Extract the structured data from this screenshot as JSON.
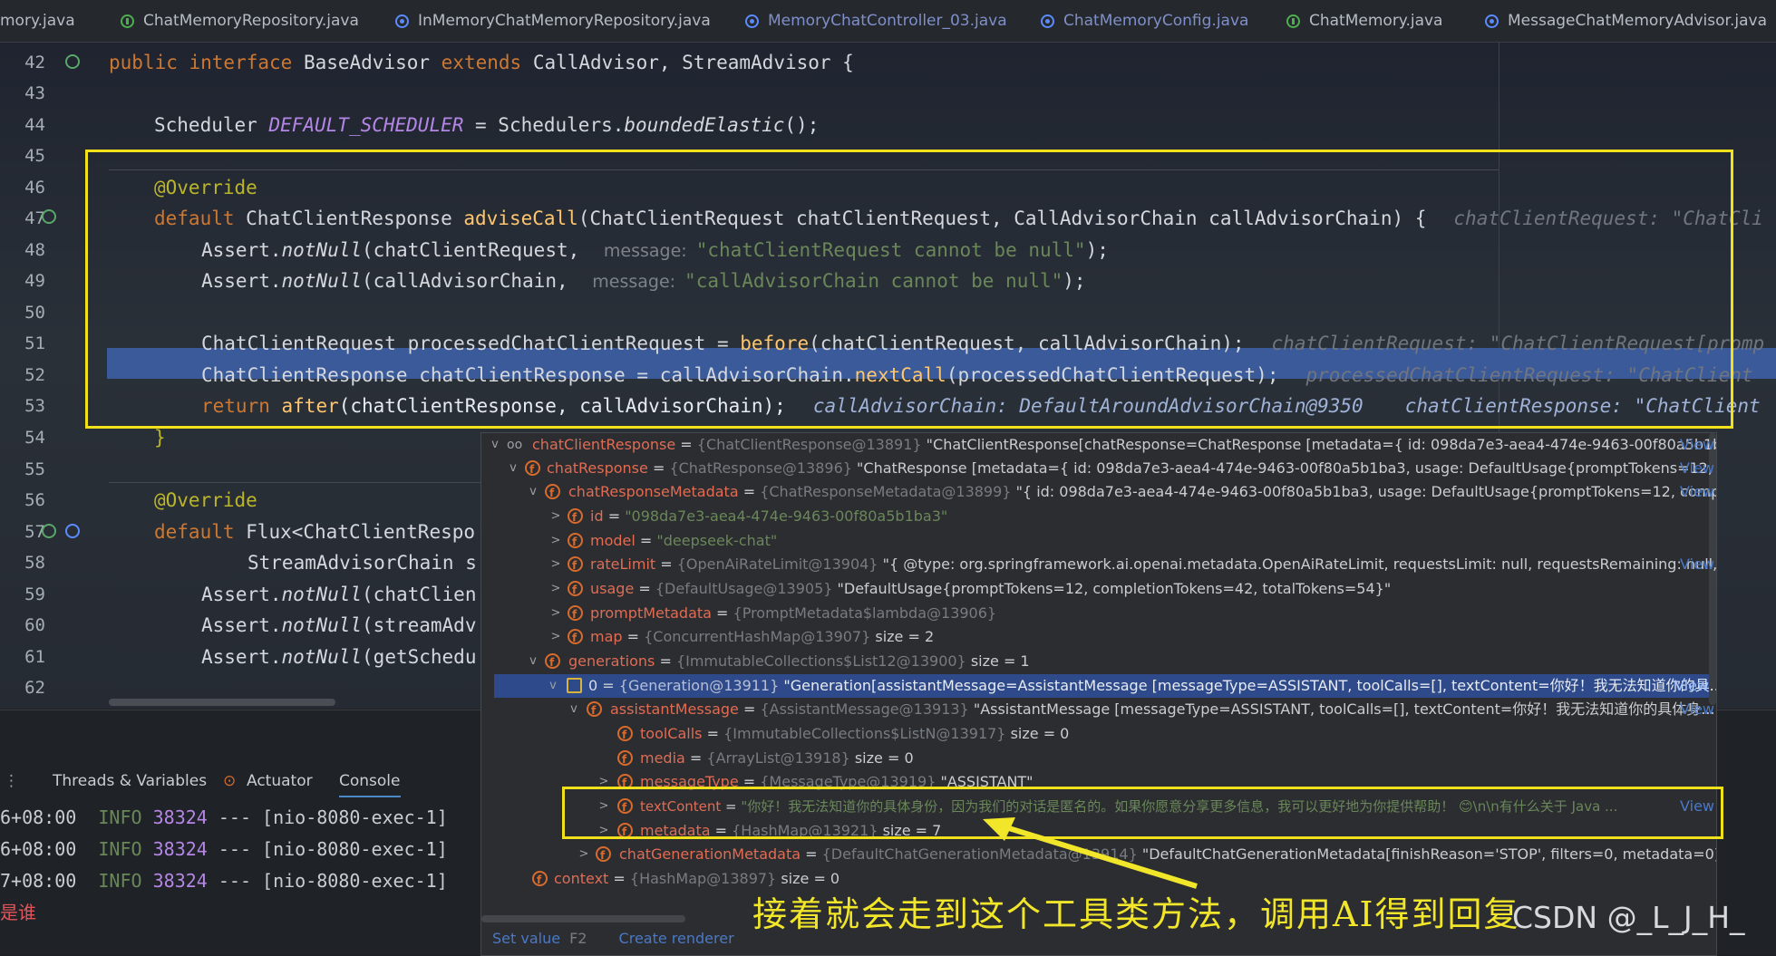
{
  "tabs": [
    {
      "label": "mory.java",
      "icon": "none"
    },
    {
      "label": "ChatMemoryRepository.java",
      "icon": "interface-icon"
    },
    {
      "label": "InMemoryChatMemoryRepository.java",
      "icon": "class-icon"
    },
    {
      "label": "MemoryChatController_03.java",
      "icon": "class-icon"
    },
    {
      "label": "ChatMemoryConfig.java",
      "icon": "class-icon"
    },
    {
      "label": "ChatMemory.java",
      "icon": "interface-icon"
    },
    {
      "label": "MessageChatMemoryAdvisor.java",
      "icon": "class-icon"
    }
  ],
  "editor": {
    "line_numbers": [
      "42",
      "43",
      "44",
      "45",
      "46",
      "47",
      "48",
      "49",
      "50",
      "51",
      "52",
      "53",
      "54",
      "55",
      "56",
      "57",
      "58",
      "59",
      "60",
      "61",
      "62"
    ],
    "l42": {
      "a": "public interface ",
      "b": "BaseAdvisor ",
      "c": "extends ",
      "d": "CallAdvisor, StreamAdvisor {"
    },
    "l44": {
      "a": "Scheduler ",
      "b": "DEFAULT_SCHEDULER",
      "c": " = Schedulers.",
      "d": "boundedElastic",
      "e": "();"
    },
    "l46": "@Override",
    "l47": {
      "a": "default ",
      "b": "ChatClientResponse ",
      "c": "adviseCall",
      "d": "(ChatClientRequest chatClientRequest, CallAdvisorChain callAdvisorChain) {",
      "hint": "chatClientRequest: \"ChatCli"
    },
    "l48": {
      "a": "Assert.",
      "b": "notNull",
      "c": "(chatClientRequest, ",
      "hint": "message:",
      "d": "\"chatClientRequest cannot be null\"",
      "e": ");"
    },
    "l49": {
      "a": "Assert.",
      "b": "notNull",
      "c": "(callAdvisorChain, ",
      "hint": "message:",
      "d": "\"callAdvisorChain cannot be null\"",
      "e": ");"
    },
    "l51": {
      "a": "ChatClientRequest processedChatClientRequest = ",
      "b": "before",
      "c": "(chatClientRequest, callAdvisorChain);",
      "hint": "chatClientRequest: \"ChatClientRequest[promp"
    },
    "l52": {
      "a": "ChatClientResponse chatClientResponse = callAdvisorChain.",
      "b": "nextCall",
      "c": "(processedChatClientRequest);",
      "hint": "processedChatClientRequest: \"ChatClient"
    },
    "l53": {
      "a": "return ",
      "b": "after",
      "c": "(chatClientResponse, callAdvisorChain);",
      "hint1": "callAdvisorChain: DefaultAroundAdvisorChain@9350",
      "hint2": "chatClientResponse: \"ChatClient"
    },
    "l54": "}",
    "l56": "@Override",
    "l57": {
      "a": "default ",
      "b": "Flux<ChatClientRespo"
    },
    "l58": "StreamAdvisorChain s",
    "l59": {
      "a": "Assert.",
      "b": "notNull",
      "c": "(chatClien"
    },
    "l60": {
      "a": "Assert.",
      "b": "notNull",
      "c": "(streamAdv"
    },
    "l61": {
      "a": "Assert.",
      "b": "notNull",
      "c": "(getSchedu"
    }
  },
  "bottom_tabs": {
    "threads": "Threads & Variables",
    "actuator": "Actuator",
    "console": "Console"
  },
  "console": [
    {
      "ts": "6+08:00",
      "level": "INFO",
      "pid": "38324",
      "rest": "--- [nio-8080-exec-1]"
    },
    {
      "ts": "6+08:00",
      "level": "INFO",
      "pid": "38324",
      "rest": "--- [nio-8080-exec-1]"
    },
    {
      "ts": "7+08:00",
      "level": "INFO",
      "pid": "38324",
      "rest": "--- [nio-8080-exec-1]"
    },
    {
      "ts": "是谁",
      "level": "",
      "pid": "",
      "rest": ""
    }
  ],
  "variables": [
    {
      "name": "chatClientResponse",
      "type": "{ChatClientResponse@13891}",
      "val": "\"ChatClientResponse[chatResponse=ChatResponse [metadata={ id: 098da7e3-aea4-474e-9463-00f80a5b1ba...",
      "view": "View",
      "icon": "oo",
      "arrow": "v"
    },
    {
      "name": "chatResponse",
      "type": "{ChatResponse@13896}",
      "val": "\"ChatResponse [metadata={ id: 098da7e3-aea4-474e-9463-00f80a5b1ba3, usage: DefaultUsage{promptTokens=12, c...",
      "view": "View",
      "icon": "f",
      "arrow": "v"
    },
    {
      "name": "chatResponseMetadata",
      "type": "{ChatResponseMetadata@13899}",
      "val": "\"{ id: 098da7e3-aea4-474e-9463-00f80a5b1ba3, usage: DefaultUsage{promptTokens=12, comp...",
      "view": "View",
      "icon": "f",
      "arrow": "v"
    },
    {
      "name": "id",
      "type": "",
      "val": "\"098da7e3-aea4-474e-9463-00f80a5b1ba3\"",
      "view": "",
      "icon": "f",
      "arrow": ">",
      "str": true
    },
    {
      "name": "model",
      "type": "",
      "val": "\"deepseek-chat\"",
      "view": "",
      "icon": "f",
      "arrow": ">",
      "str": true
    },
    {
      "name": "rateLimit",
      "type": "{OpenAiRateLimit@13904}",
      "val": "\"{ @type: org.springframework.ai.openai.metadata.OpenAiRateLimit, requestsLimit: null, requestsRemaining: null,...",
      "view": "View",
      "icon": "f",
      "arrow": ">"
    },
    {
      "name": "usage",
      "type": "{DefaultUsage@13905}",
      "val": "\"DefaultUsage{promptTokens=12, completionTokens=42, totalTokens=54}\"",
      "view": "",
      "icon": "f",
      "arrow": ">"
    },
    {
      "name": "promptMetadata",
      "type": "{PromptMetadata$lambda@13906}",
      "val": "",
      "view": "",
      "icon": "f",
      "arrow": ">"
    },
    {
      "name": "map",
      "type": "{ConcurrentHashMap@13907}",
      "val": "size = 2",
      "view": "",
      "icon": "f",
      "arrow": ">"
    },
    {
      "name": "generations",
      "type": "{ImmutableCollections$List12@13900}",
      "val": "size = 1",
      "view": "",
      "icon": "f",
      "arrow": "v"
    },
    {
      "name": "0",
      "type": "{Generation@13911}",
      "val": "\"Generation[assistantMessage=AssistantMessage [messageType=ASSISTANT, toolCalls=[], textContent=你好！我无法知道你的具...",
      "view": "View",
      "icon": "list",
      "arrow": "v"
    },
    {
      "name": "assistantMessage",
      "type": "{AssistantMessage@13913}",
      "val": "\"AssistantMessage [messageType=ASSISTANT, toolCalls=[], textContent=你好！我无法知道你的具体身...",
      "view": "View",
      "icon": "f",
      "arrow": "v"
    },
    {
      "name": "toolCalls",
      "type": "{ImmutableCollections$ListN@13917}",
      "val": "size = 0",
      "view": "",
      "icon": "f",
      "arrow": ""
    },
    {
      "name": "media",
      "type": "{ArrayList@13918}",
      "val": "size = 0",
      "view": "",
      "icon": "f",
      "arrow": ""
    },
    {
      "name": "messageType",
      "type": "{MessageType@13919}",
      "val": "\"ASSISTANT\"",
      "view": "",
      "icon": "f",
      "arrow": ">"
    },
    {
      "name": "textContent",
      "type": "",
      "val": "\"你好！我无法知道你的具体身份，因为我们的对话是匿名的。如果你愿意分享更多信息，我可以更好地为你提供帮助！ 😊\\n\\n有什么关于 Java ...",
      "view": "View",
      "icon": "f",
      "arrow": ">",
      "str": true
    },
    {
      "name": "metadata",
      "type": "{HashMap@13921}",
      "val": "size = 7",
      "view": "",
      "icon": "f",
      "arrow": ">"
    },
    {
      "name": "chatGenerationMetadata",
      "type": "{DefaultChatGenerationMetadata@13914}",
      "val": "\"DefaultChatGenerationMetadata[finishReason='STOP', filters=0, metadata=0]\"",
      "view": "",
      "icon": "f",
      "arrow": ">"
    },
    {
      "name": "context",
      "type": "{HashMap@13897}",
      "val": "size = 0",
      "view": "",
      "icon": "f",
      "arrow": ""
    }
  ],
  "popup_footer": {
    "set_value": "Set value",
    "set_key": "F2",
    "create_renderer": "Create renderer"
  },
  "annotation": "接着就会走到这个工具类方法，调用AI得到回复",
  "watermark": "CSDN @_L_J_H_"
}
